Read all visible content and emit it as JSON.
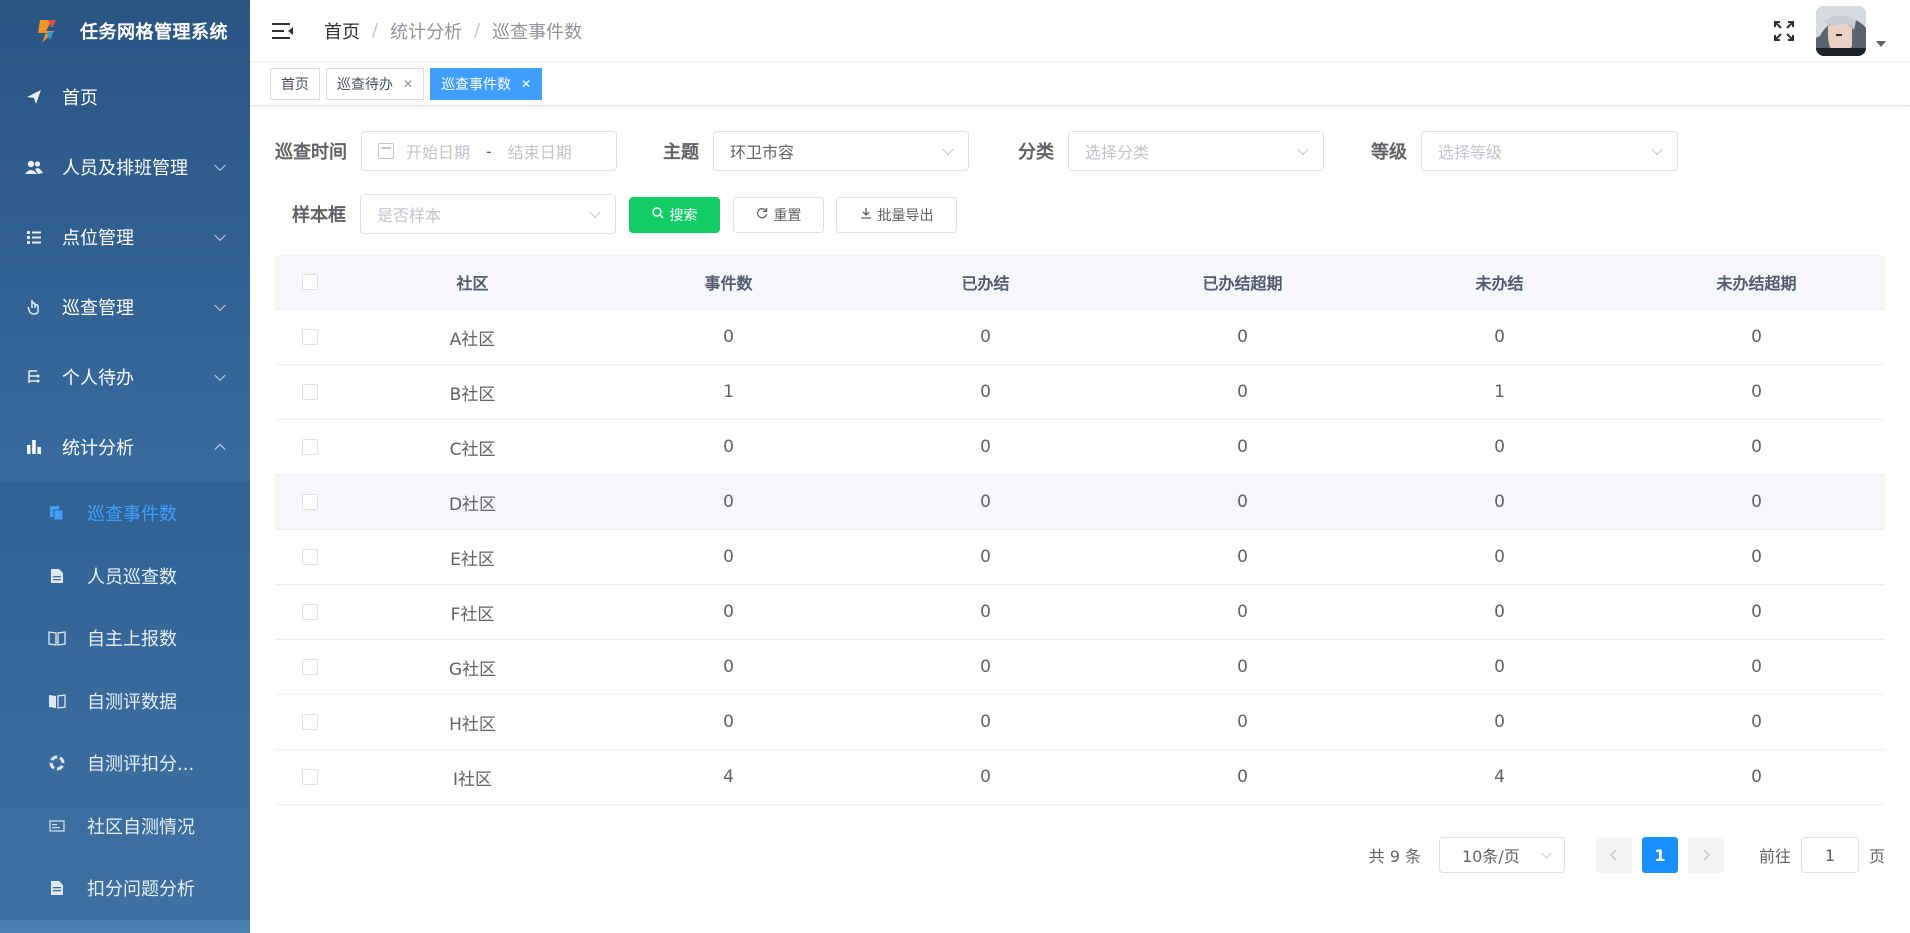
{
  "app": {
    "title": "任务网格管理系统"
  },
  "sidebar": {
    "items": [
      {
        "label": "首页",
        "icon": "send-icon"
      },
      {
        "label": "人员及排班管理",
        "icon": "people-icon"
      },
      {
        "label": "点位管理",
        "icon": "list-tree-icon"
      },
      {
        "label": "巡查管理",
        "icon": "hand-icon"
      },
      {
        "label": "个人待办",
        "icon": "todo-icon"
      },
      {
        "label": "统计分析",
        "icon": "bar-chart-icon"
      }
    ],
    "subitems": [
      {
        "label": "巡查事件数",
        "icon": "copy-icon"
      },
      {
        "label": "人员巡查数",
        "icon": "document-icon"
      },
      {
        "label": "自主上报数",
        "icon": "book-icon"
      },
      {
        "label": "自测评数据",
        "icon": "open-book-icon"
      },
      {
        "label": "自测评扣分...",
        "icon": "lifebuoy-icon"
      },
      {
        "label": "社区自测情况",
        "icon": "card-icon"
      },
      {
        "label": "扣分问题分析",
        "icon": "file-text-icon"
      }
    ]
  },
  "header": {
    "breadcrumb": [
      "首页",
      "统计分析",
      "巡查事件数"
    ]
  },
  "tags": [
    {
      "label": "首页",
      "closable": false
    },
    {
      "label": "巡查待办",
      "closable": true
    },
    {
      "label": "巡查事件数",
      "closable": true
    }
  ],
  "filters": {
    "time_label": "巡查时间",
    "start_placeholder": "开始日期",
    "range_sep": "-",
    "end_placeholder": "结束日期",
    "topic_label": "主题",
    "topic_value": "环卫市容",
    "category_label": "分类",
    "category_placeholder": "选择分类",
    "level_label": "等级",
    "level_placeholder": "选择等级",
    "sample_label": "样本框",
    "sample_placeholder": "是否样本",
    "search_label": "搜索",
    "reset_label": "重置",
    "export_label": "批量导出"
  },
  "table": {
    "columns": [
      "社区",
      "事件数",
      "已办结",
      "已办结超期",
      "未办结",
      "未办结超期"
    ],
    "rows": [
      [
        "A社区",
        "0",
        "0",
        "0",
        "0",
        "0"
      ],
      [
        "B社区",
        "1",
        "0",
        "0",
        "1",
        "0"
      ],
      [
        "C社区",
        "0",
        "0",
        "0",
        "0",
        "0"
      ],
      [
        "D社区",
        "0",
        "0",
        "0",
        "0",
        "0"
      ],
      [
        "E社区",
        "0",
        "0",
        "0",
        "0",
        "0"
      ],
      [
        "F社区",
        "0",
        "0",
        "0",
        "0",
        "0"
      ],
      [
        "G社区",
        "0",
        "0",
        "0",
        "0",
        "0"
      ],
      [
        "H社区",
        "0",
        "0",
        "0",
        "0",
        "0"
      ],
      [
        "I社区",
        "4",
        "0",
        "0",
        "4",
        "0"
      ]
    ]
  },
  "pagination": {
    "total": "共 9 条",
    "page_size": "10条/页",
    "current_page": "1",
    "goto_prefix": "前往",
    "goto_value": "1",
    "goto_suffix": "页"
  },
  "colors": {
    "sidebar_bg": "#2a5583",
    "accent": "#409eff",
    "search_button": "#13ce66",
    "active_page": "#1890ff"
  }
}
